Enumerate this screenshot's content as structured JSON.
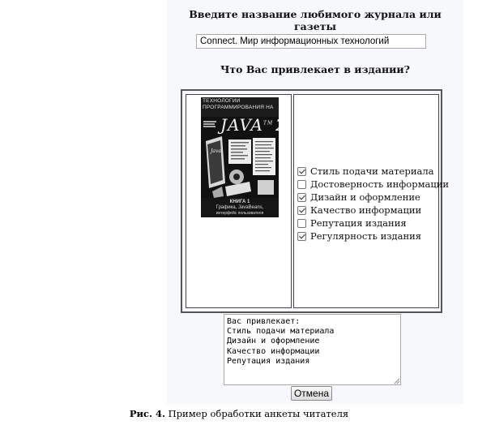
{
  "form": {
    "journal_prompt": "Введите название любимого журнала или газеты",
    "journal_value": "Connect. Мир информационных технологий",
    "attraction_prompt": "Что Вас привлекает в издании?"
  },
  "book_cover": {
    "title_line1": "ТЕХНОЛОГИИ",
    "title_line2": "ПРОГРАММИРОВАНИЯ НА",
    "java_mark": "JAVA",
    "version": "2",
    "volume": "КНИГА 1",
    "subtitle_line1": "Графика, JavaBeans,",
    "subtitle_line2": "интерфейс пользователя"
  },
  "checkboxes": [
    {
      "label": "Стиль подачи материала",
      "checked": true
    },
    {
      "label": "Достоверность информации",
      "checked": false
    },
    {
      "label": "Дизайн и оформление",
      "checked": true
    },
    {
      "label": "Качество информации",
      "checked": true
    },
    {
      "label": "Репутация издания",
      "checked": false
    },
    {
      "label": "Регулярность издания",
      "checked": true
    }
  ],
  "result": {
    "text": "Вас привлекает:\nСтиль подачи материала\nДизайн и оформление\nКачество информации\nРепутация издания"
  },
  "buttons": {
    "cancel_label": "Отмена"
  },
  "caption": {
    "label": "Рис. 4.",
    "text": " Пример обработки анкеты читателя"
  }
}
